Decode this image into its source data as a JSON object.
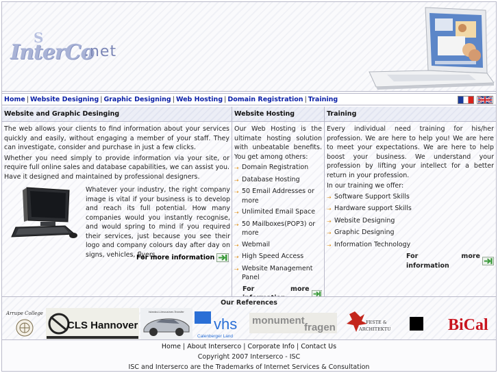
{
  "header": {
    "logo_text_main": "InterCo",
    "logo_text_suffix": ".net",
    "logo_text_top": "S"
  },
  "nav": {
    "items": [
      "Home",
      "Website Designing",
      "Graphic Designing",
      "Web Hosting",
      "Domain Registration",
      "Training"
    ],
    "separator": "|",
    "languages": [
      "French",
      "English"
    ]
  },
  "col1": {
    "title": "Website and Graphic Desinging",
    "p1": "The web allows your clients to find information about your services quickly and easily, without engaging a member of your staff. They can investigate, consider and purchase in just a few clicks.",
    "p2": "Whether you need simply to provide information via your site, or require full online sales and database capabilities, we can assist you. Have it designed and maintained by professional designers.",
    "p3": "Whatever your industry, the right company image is vital if your business is to develop and reach its full potential. How many companies would you instantly recognise, and would spring to mind if you required their services, just because you see their logo and company colours day after day on signs, vehicles, flyers...",
    "more": "For more information"
  },
  "col2": {
    "title": "Website Hosting",
    "intro": "Our Web Hosting is the ultimate hosting solution with unbeatable benefits. You get among others:",
    "items": [
      "Domain Registration",
      "Database Hosting",
      "50 Email Addresses or more",
      "Unlimited Email Space",
      "50 Mailboxes(POP3) or more",
      "Webmail",
      "High Speed Access",
      "Website Management Panel"
    ],
    "more": "For more information"
  },
  "col3": {
    "title": "Training",
    "intro": "Every individual need training for his/her profession. We are here to help you! We are here to meet your expectations. We are here to help boost your business. We understand your profession by lifting your intellect for a better return in your profession.",
    "offer": "In our training we offer:",
    "items": [
      "Software Support Skills",
      "Hardware support Skills",
      "Website Designing",
      "Graphic Designing",
      "Information Technology"
    ],
    "more": "For more information"
  },
  "references": {
    "title": "Our References",
    "logos": [
      {
        "name": "Arrupe College",
        "label": "Arrupe College"
      },
      {
        "name": "CLS Hannover",
        "label": "CLS Hannover"
      },
      {
        "name": "Car transfer",
        "label": "Istanbul-Limousinen-Transfer"
      },
      {
        "name": "vhs Calenberger Land",
        "label": "vhs",
        "sub": "Calenberger Land"
      },
      {
        "name": "monument fragen",
        "label1": "monument",
        "label2": "fragen"
      },
      {
        "name": "Feste & Architektur",
        "label1": "FESTE &",
        "label2": "ARCHITEKTUR"
      },
      {
        "name": "black square logo",
        "label": ""
      },
      {
        "name": "BiCal",
        "label": "BiCal"
      }
    ]
  },
  "footer": {
    "links": [
      "Home",
      "About Interserco",
      "Corporate Info",
      "Contact Us"
    ],
    "copyright": "Copyright 2007 Interserco - ISC",
    "trademark": "ISC and Interserco are the Trademarks of Internet Services & Consultation"
  },
  "colors": {
    "nav_link": "#0d22a8",
    "border": "#b9b9c9",
    "bullet": "#e09018",
    "arrow_green": "#3a9a3a"
  }
}
